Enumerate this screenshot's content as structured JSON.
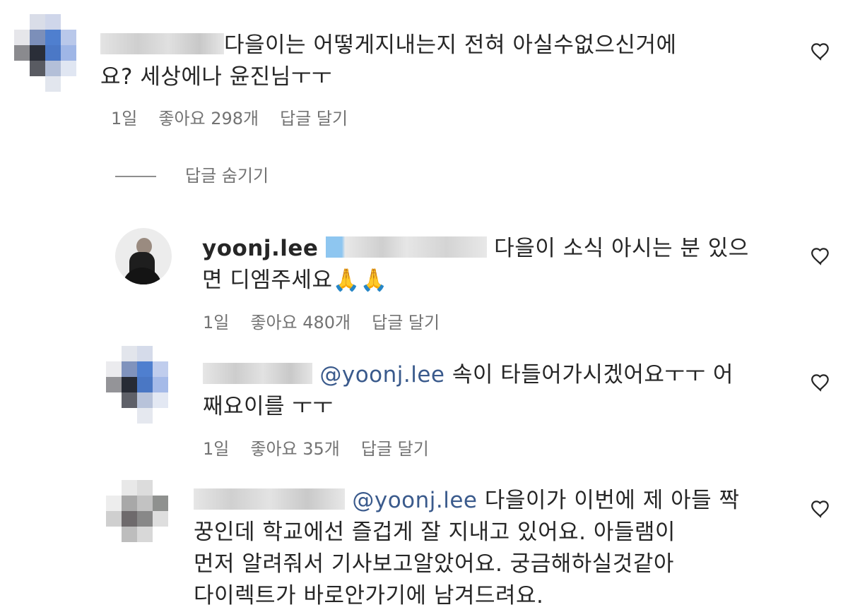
{
  "comments": [
    {
      "text_line1": "다을이는 어떻게지내는지 전혀 아실수없으신거에",
      "text_line2": "요? 세상에나 윤진님ㅜㅜ",
      "meta": {
        "time": "1일",
        "likes": "좋아요 298개",
        "reply": "답글 달기"
      }
    }
  ],
  "hide_replies": "답글 숨기기",
  "replies": [
    {
      "username": "yoonj.lee",
      "text_line1": "다을이 소식 아시는 분 있으",
      "text_line2": "면 디엠주세요🙏🙏",
      "meta": {
        "time": "1일",
        "likes": "좋아요 480개",
        "reply": "답글 달기"
      }
    },
    {
      "mention": "@yoonj.lee",
      "text_line1": "속이 타들어가시겠어요ㅜㅜ 어",
      "text_line2": "째요이를 ㅜㅜ",
      "meta": {
        "time": "1일",
        "likes": "좋아요 35개",
        "reply": "답글 달기"
      }
    },
    {
      "mention": "@yoonj.lee",
      "text_line1": "다을이가 이번에 제 아들 짝",
      "text_line2": "꿍인데 학교에선 즐겁게 잘 지내고 있어요. 아들램이",
      "text_line3": "먼저 알려줘서 기사보고알았어요. 궁금해하실것같아",
      "text_line4": "다이렉트가 바로안가기에 남겨드려요."
    }
  ],
  "colors": {
    "text": "#262626",
    "meta": "#737373",
    "mention": "#3a5a8c"
  },
  "icons": [
    "heart-icon"
  ]
}
